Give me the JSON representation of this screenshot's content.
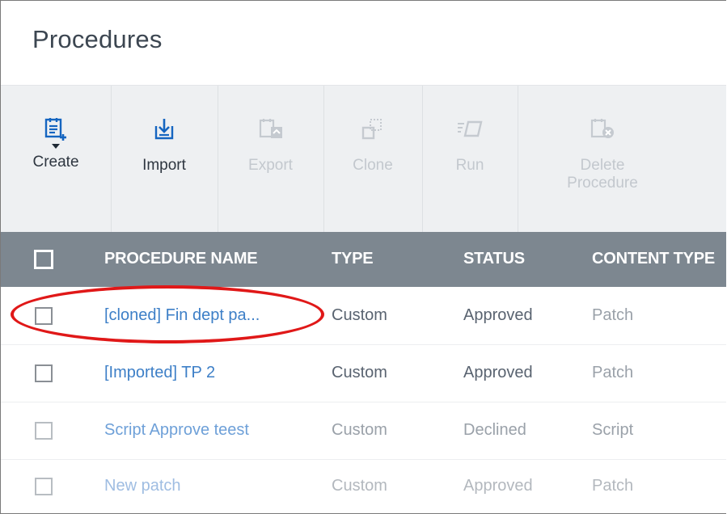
{
  "page": {
    "title": "Procedures"
  },
  "toolbar": {
    "create": "Create",
    "import": "Import",
    "export": "Export",
    "clone": "Clone",
    "run": "Run",
    "delete_line1": "Delete",
    "delete_line2": "Procedure"
  },
  "table": {
    "columns": {
      "name": "PROCEDURE NAME",
      "type": "TYPE",
      "status": "STATUS",
      "content_type": "CONTENT TYPE"
    },
    "rows": [
      {
        "name": "[cloned] Fin dept pa...",
        "type": "Custom",
        "status": "Approved",
        "content_type": "Patch"
      },
      {
        "name": "[Imported] TP 2",
        "type": "Custom",
        "status": "Approved",
        "content_type": "Patch"
      },
      {
        "name": "Script Approve teest",
        "type": "Custom",
        "status": "Declined",
        "content_type": "Script"
      },
      {
        "name": "New patch",
        "type": "Custom",
        "status": "Approved",
        "content_type": "Patch"
      }
    ]
  },
  "colors": {
    "accent": "#3d7fc7",
    "header_bg": "#7d8790",
    "highlight": "#e01818",
    "toolbar_bg": "#eef0f2"
  }
}
